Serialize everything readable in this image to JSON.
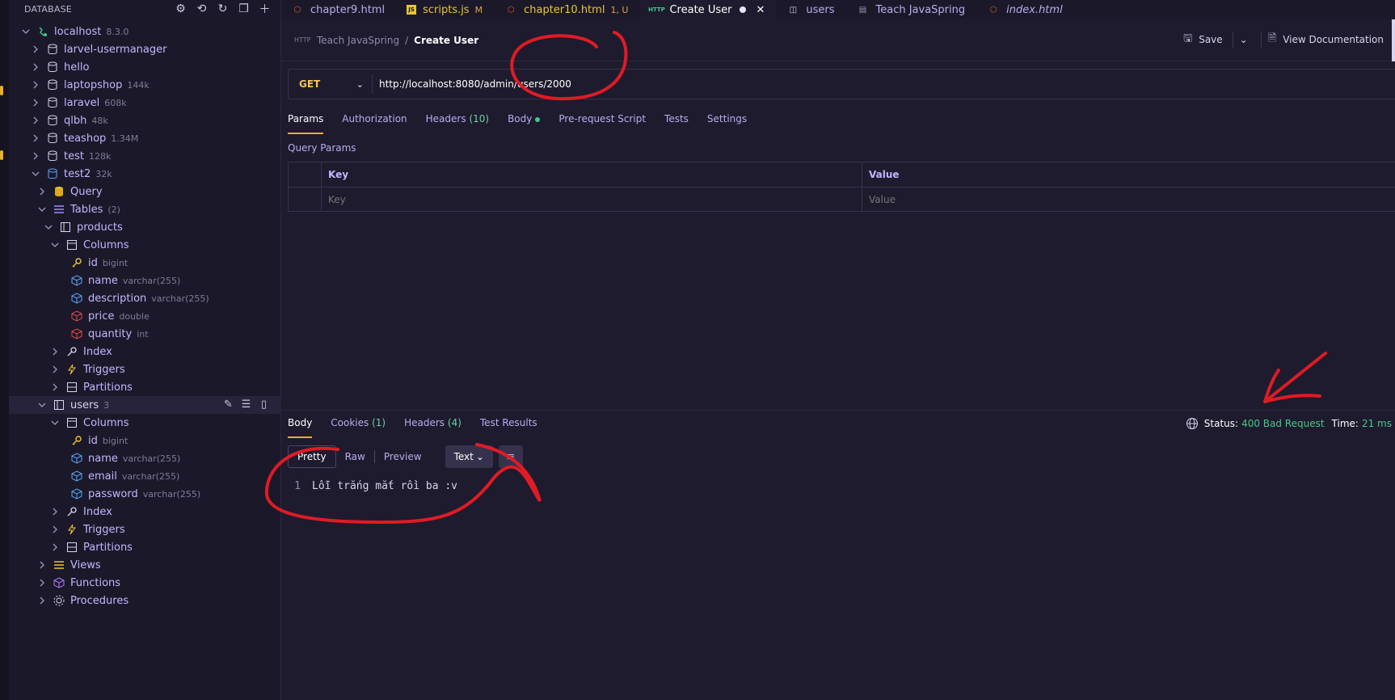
{
  "sidebar": {
    "title": "DATABASE",
    "tree": [
      {
        "label": "localhost",
        "meta": "8.3.0",
        "icon": "server-icon"
      },
      {
        "label": "larvel-usermanager",
        "meta": "",
        "icon": "database-icon"
      },
      {
        "label": "hello",
        "meta": "",
        "icon": "database-icon"
      },
      {
        "label": "laptopshop",
        "meta": "144k",
        "icon": "database-icon"
      },
      {
        "label": "laravel",
        "meta": "608k",
        "icon": "database-icon"
      },
      {
        "label": "qlbh",
        "meta": "48k",
        "icon": "database-icon"
      },
      {
        "label": "teashop",
        "meta": "1.34M",
        "icon": "database-icon"
      },
      {
        "label": "test",
        "meta": "128k",
        "icon": "database-icon"
      },
      {
        "label": "test2",
        "meta": "32k",
        "icon": "database-icon"
      },
      {
        "label": "Query",
        "meta": "",
        "icon": "query-icon"
      },
      {
        "label": "Tables",
        "meta": "(2)",
        "icon": "tables-icon"
      },
      {
        "label": "products",
        "meta": "",
        "icon": "table-icon"
      },
      {
        "label": "Columns",
        "meta": "",
        "icon": "columns-icon"
      },
      {
        "label": "id",
        "meta": "bigint",
        "icon": "key-icon"
      },
      {
        "label": "name",
        "meta": "varchar(255)",
        "icon": "column-icon"
      },
      {
        "label": "description",
        "meta": "varchar(255)",
        "icon": "column-icon"
      },
      {
        "label": "price",
        "meta": "double",
        "icon": "column-required-icon"
      },
      {
        "label": "quantity",
        "meta": "int",
        "icon": "column-required-icon"
      },
      {
        "label": "Index",
        "meta": "",
        "icon": "index-key-icon"
      },
      {
        "label": "Triggers",
        "meta": "",
        "icon": "bolt-icon"
      },
      {
        "label": "Partitions",
        "meta": "",
        "icon": "partitions-icon"
      },
      {
        "label": "users",
        "meta": "3",
        "icon": "table-icon"
      },
      {
        "label": "Columns",
        "meta": "",
        "icon": "columns-icon"
      },
      {
        "label": "id",
        "meta": "bigint",
        "icon": "key-icon"
      },
      {
        "label": "name",
        "meta": "varchar(255)",
        "icon": "column-icon"
      },
      {
        "label": "email",
        "meta": "varchar(255)",
        "icon": "column-icon"
      },
      {
        "label": "password",
        "meta": "varchar(255)",
        "icon": "column-icon"
      },
      {
        "label": "Index",
        "meta": "",
        "icon": "index-key-icon"
      },
      {
        "label": "Triggers",
        "meta": "",
        "icon": "bolt-icon"
      },
      {
        "label": "Partitions",
        "meta": "",
        "icon": "partitions-icon"
      },
      {
        "label": "Views",
        "meta": "",
        "icon": "views-icon"
      },
      {
        "label": "Functions",
        "meta": "",
        "icon": "function-icon"
      },
      {
        "label": "Procedures",
        "meta": "",
        "icon": "procedure-icon"
      }
    ]
  },
  "tabs": [
    {
      "label": "chapter9.html",
      "mod": "",
      "icon": "html5-icon"
    },
    {
      "label": "scripts.js",
      "mod": "M",
      "icon": "js-icon"
    },
    {
      "label": "chapter10.html",
      "mod": "1, U",
      "icon": "html5-icon"
    },
    {
      "label": "Create User",
      "mod": "",
      "icon": "http-icon"
    },
    {
      "label": "users",
      "mod": "",
      "icon": "table-icon"
    },
    {
      "label": "Teach JavaSpring",
      "mod": "",
      "icon": "collection-icon"
    },
    {
      "label": "index.html",
      "mod": "",
      "icon": "html5-icon"
    }
  ],
  "breadcrumb": {
    "collection": "Teach JavaSpring",
    "separator": "/",
    "request": "Create User"
  },
  "toolbar": {
    "save_label": "Save",
    "docs_label": "View Documentation"
  },
  "request": {
    "method": "GET",
    "url": "http://localhost:8080/admin/users/2000",
    "tabs": {
      "params": "Params",
      "authorization": "Authorization",
      "headers": "Headers",
      "headers_count": "(10)",
      "body": "Body",
      "prerequest": "Pre-request Script",
      "tests": "Tests",
      "settings": "Settings"
    },
    "query_params": {
      "title": "Query Params",
      "key_header": "Key",
      "value_header": "Value",
      "key_placeholder": "Key",
      "value_placeholder": "Value"
    }
  },
  "response": {
    "tabs": {
      "body": "Body",
      "cookies": "Cookies",
      "cookies_count": "(1)",
      "headers": "Headers",
      "headers_count": "(4)",
      "test_results": "Test Results"
    },
    "status_label": "Status:",
    "status_value": "400 Bad Request",
    "time_label": "Time:",
    "time_value": "21 ms",
    "views": {
      "pretty": "Pretty",
      "raw": "Raw",
      "preview": "Preview",
      "format": "Text"
    },
    "body_lines": [
      {
        "n": "1",
        "text": "Lỗi trắng mắt rồi ba :v"
      }
    ]
  },
  "colors": {
    "accent": "#e8b028",
    "success": "#45c98a",
    "annotation": "#e01b24"
  }
}
